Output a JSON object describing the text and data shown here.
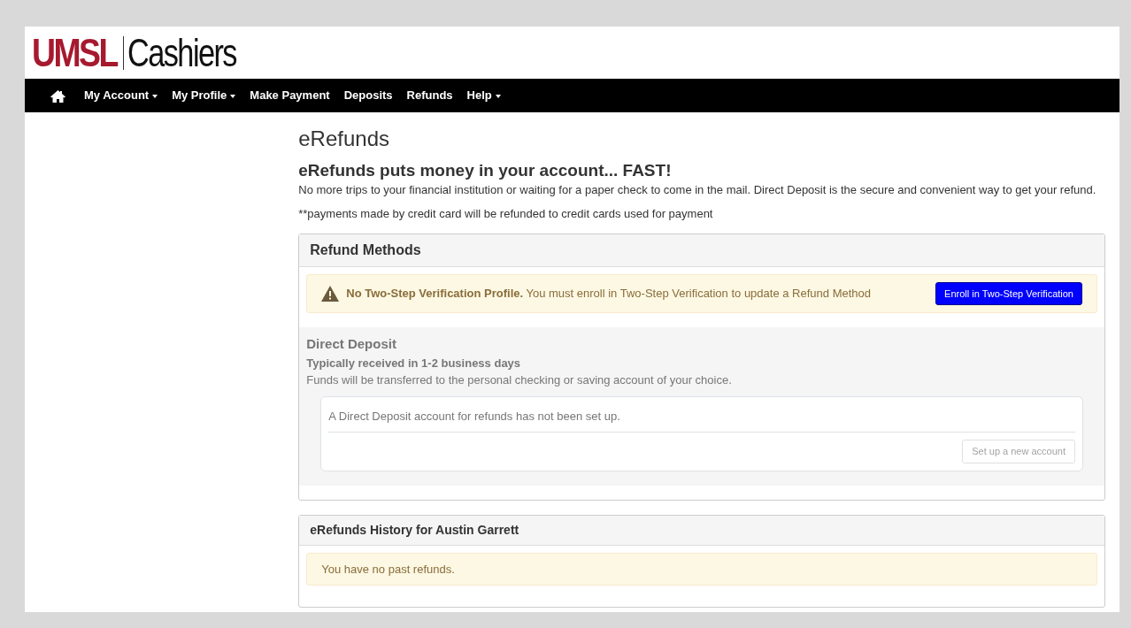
{
  "logo": {
    "brand": "UMSL",
    "unit": "Cashiers"
  },
  "nav": [
    {
      "kind": "home"
    },
    {
      "kind": "link",
      "label": "My Account",
      "dropdown": true
    },
    {
      "kind": "link",
      "label": "My Profile",
      "dropdown": true
    },
    {
      "kind": "link",
      "label": "Make Payment",
      "dropdown": false
    },
    {
      "kind": "link",
      "label": "Deposits",
      "dropdown": false
    },
    {
      "kind": "link",
      "label": "Refunds",
      "dropdown": false
    },
    {
      "kind": "link",
      "label": "Help",
      "dropdown": true
    }
  ],
  "page_title": "eRefunds",
  "headline": "eRefunds puts money in your account... FAST!",
  "intro": "No more trips to your financial institution or waiting for a paper check to come in the mail. Direct Deposit is the secure and convenient way to get your refund.",
  "note": "**payments made by credit card will be refunded to credit cards used for payment",
  "refund_methods": {
    "title": "Refund Methods",
    "warning": {
      "text": "**No Two-Step Verification Profile.** You must enroll in Two-Step Verification to update a Refund Method",
      "button": "Enroll in Two-Step Verification"
    },
    "direct_deposit": {
      "title": "Direct Deposit",
      "subtitle": "Typically received in 1-2 business days",
      "description": "Funds will be transferred to the personal checking or saving account of your choice.",
      "status": "A Direct Deposit account for refunds has not been set up.",
      "button": "Set up a new account",
      "disabled": true
    }
  },
  "history": {
    "title": "eRefunds History for Austin Garrett",
    "message": "You have no past refunds."
  }
}
